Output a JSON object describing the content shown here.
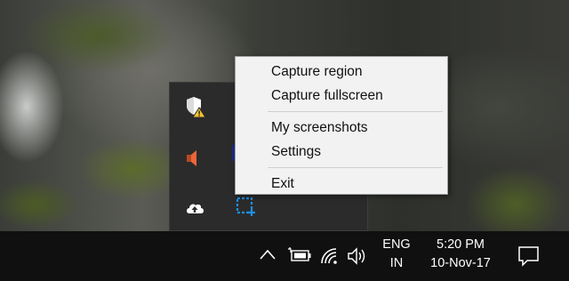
{
  "context_menu": {
    "items": [
      {
        "label": "Capture region"
      },
      {
        "label": "Capture fullscreen"
      },
      {
        "label": "My screenshots"
      },
      {
        "label": "Settings"
      },
      {
        "label": "Exit"
      }
    ]
  },
  "tray_flyout": {
    "icons": [
      "shield-warning-icon",
      "speaker-icon",
      "upload-cloud-icon",
      "screenshot-region-icon"
    ]
  },
  "taskbar": {
    "language": {
      "line1": "ENG",
      "line2": "IN"
    },
    "clock": {
      "time": "5:20 PM",
      "date": "10-Nov-17"
    },
    "icons": [
      "chevron-up-icon",
      "battery-charging-icon",
      "wifi-icon",
      "volume-icon",
      "notification-icon"
    ]
  },
  "colors": {
    "menu_bg": "#f2f2f2",
    "taskbar_bg": "#101010",
    "flyout_bg": "#2b2b2b",
    "accent_blue": "#1e8fe6",
    "warning_yellow": "#f4c430",
    "speaker_orange": "#e8663a"
  }
}
